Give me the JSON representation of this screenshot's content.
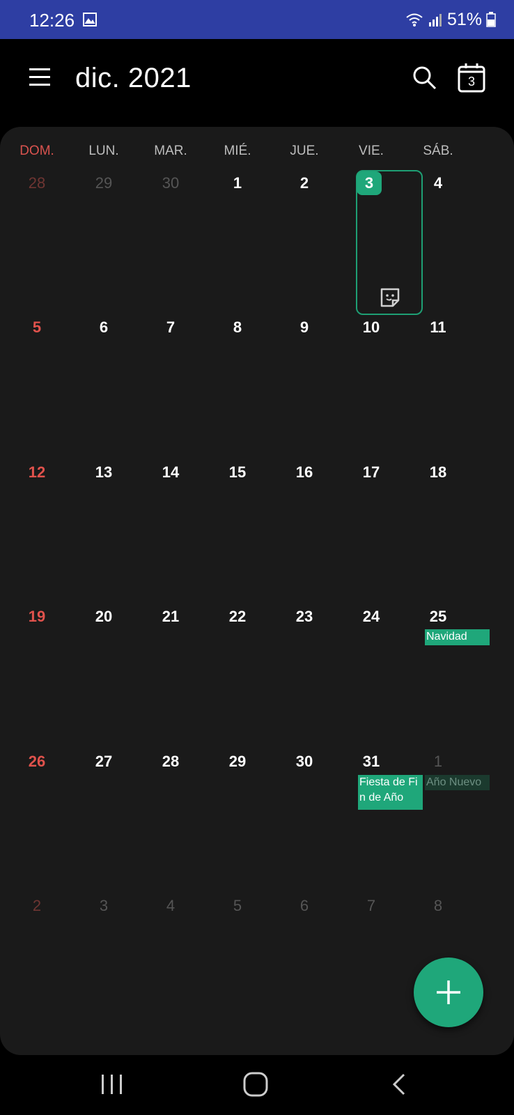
{
  "status": {
    "time": "12:26",
    "battery": "51%"
  },
  "header": {
    "month_title": "dic. 2021"
  },
  "today_button": {
    "day": "3"
  },
  "weekdays": [
    "DOM.",
    "LUN.",
    "MAR.",
    "MIÉ.",
    "JUE.",
    "VIE.",
    "SÁB."
  ],
  "weeks": [
    [
      "28",
      "29",
      "30",
      "1",
      "2",
      "3",
      "4"
    ],
    [
      "5",
      "6",
      "7",
      "8",
      "9",
      "10",
      "11"
    ],
    [
      "12",
      "13",
      "14",
      "15",
      "16",
      "17",
      "18"
    ],
    [
      "19",
      "20",
      "21",
      "22",
      "23",
      "24",
      "25"
    ],
    [
      "26",
      "27",
      "28",
      "29",
      "30",
      "31",
      "1"
    ],
    [
      "2",
      "3",
      "4",
      "5",
      "6",
      "7",
      "8"
    ]
  ],
  "today": "3",
  "events": {
    "navidad": "Navidad",
    "fiesta": "Fiesta de Fin de Año",
    "nuevo": "Año Nuevo"
  },
  "colors": {
    "accent": "#1fa77a",
    "statusbar": "#2e3ea3",
    "sunday": "#e0524c"
  },
  "icons": {
    "menu": "hamburger-icon",
    "search": "search-icon",
    "today": "calendar-today-icon",
    "fab": "plus-icon",
    "sticker": "sticker-icon"
  }
}
